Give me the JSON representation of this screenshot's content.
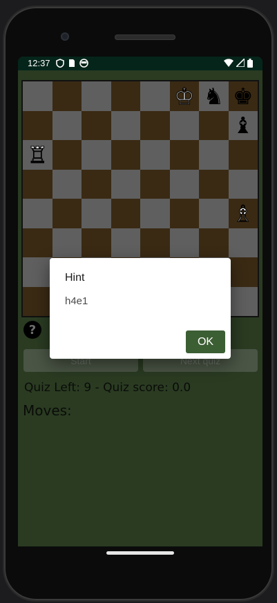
{
  "status": {
    "time": "12:37",
    "left_icons": [
      "shield-icon",
      "sim-icon",
      "globe-icon"
    ],
    "right_icons": [
      "wifi-icon",
      "signal-icon",
      "battery-icon"
    ]
  },
  "board": {
    "rows": [
      [
        "",
        "",
        "",
        "",
        "",
        "♔",
        "♞",
        "♚"
      ],
      [
        "",
        "",
        "",
        "",
        "",
        "",
        "",
        "♝"
      ],
      [
        "♖",
        "",
        "",
        "",
        "",
        "",
        "",
        ""
      ],
      [
        "",
        "",
        "",
        "",
        "",
        "",
        "",
        ""
      ],
      [
        "",
        "",
        "",
        "",
        "",
        "",
        "",
        "♗"
      ],
      [
        "",
        "",
        "",
        "",
        "",
        "",
        "",
        ""
      ],
      [
        "",
        "",
        "",
        "",
        "",
        "",
        "",
        ""
      ],
      [
        "",
        "",
        "",
        "",
        "",
        "",
        "",
        ""
      ]
    ],
    "light_color": "#5f5f5f",
    "dark_color": "#3a2a14"
  },
  "controls": {
    "hint_icon": "?",
    "start_label": "Start",
    "next_label": "Next quiz"
  },
  "quiz": {
    "score_text": "Quiz Left: 9  -  Quiz score: 0.0",
    "moves_label": "Moves:"
  },
  "dialog": {
    "title": "Hint",
    "message": "h4e1",
    "ok_label": "OK"
  },
  "colors": {
    "accent": "#3c5e33",
    "screen_bg": "#2a3b22",
    "statusbar_bg": "#05251a"
  }
}
